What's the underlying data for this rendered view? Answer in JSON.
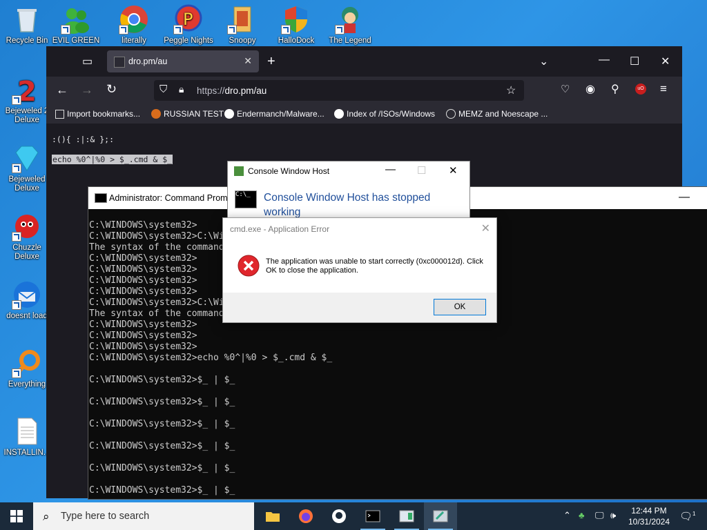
{
  "desktop": {
    "top_icons": [
      {
        "label": "Recycle Bin"
      },
      {
        "label": "EVIL GREEN"
      },
      {
        "label": "literally"
      },
      {
        "label": "Peggle Nights"
      },
      {
        "label": "Snoopy"
      },
      {
        "label": "HalloDock"
      },
      {
        "label": "The Legend"
      }
    ],
    "left_icons": [
      {
        "label": "Bejeweled 2 Deluxe"
      },
      {
        "label": "Bejeweled Deluxe"
      },
      {
        "label": "Chuzzle Deluxe"
      },
      {
        "label": "doesnt load"
      },
      {
        "label": "Everything"
      },
      {
        "label": "INSTALLIN..."
      }
    ]
  },
  "browser": {
    "tab_title": "dro.pm/au",
    "url_scheme": "https://",
    "url_host": "dro.pm/au",
    "bookmarks": [
      {
        "label": "Import bookmarks..."
      },
      {
        "label": "RUSSIAN TEST"
      },
      {
        "label": "Endermanch/Malware..."
      },
      {
        "label": "Index of /ISOs/Windows"
      },
      {
        "label": "MEMZ and Noescape ..."
      }
    ],
    "content_line1": ":(){ :|:& };:",
    "content_line2": "echo %0^|%0 > $_.cmd & $_"
  },
  "cmd": {
    "title": "Administrator: Command Prompt",
    "lines": [
      "C:\\WINDOWS\\system32>",
      "C:\\WINDOWS\\system32>C:\\Wi",
      "The syntax of the command",
      "C:\\WINDOWS\\system32>",
      "C:\\WINDOWS\\system32>",
      "C:\\WINDOWS\\system32>",
      "C:\\WINDOWS\\system32>",
      "C:\\WINDOWS\\system32>C:\\Wi",
      "The syntax of the command",
      "C:\\WINDOWS\\system32>",
      "C:\\WINDOWS\\system32>",
      "C:\\WINDOWS\\system32>",
      "C:\\WINDOWS\\system32>echo %0^|%0 > $_.cmd & $_",
      "",
      "C:\\WINDOWS\\system32>$_ | $_",
      "",
      "C:\\WINDOWS\\system32>$_ | $_",
      "",
      "C:\\WINDOWS\\system32>$_ | $_",
      "",
      "C:\\WINDOWS\\system32>$_ | $_",
      "",
      "C:\\WINDOWS\\system32>$_ | $_",
      "",
      "C:\\WINDOWS\\system32>$_ | $_"
    ]
  },
  "cwh_dialog": {
    "title": "Console Window Host",
    "message": "Console Window Host has stopped working"
  },
  "error_dialog": {
    "title": "cmd.exe - Application Error",
    "message": "The application was unable to start correctly (0xc000012d). Click OK to close the application.",
    "ok_label": "OK"
  },
  "taskbar": {
    "search_placeholder": "Type here to search",
    "time": "12:44 PM",
    "date": "10/31/2024",
    "notification_count": "1"
  },
  "colors": {
    "desktop": "#2e95e6",
    "browser_bg": "#1c1b22",
    "accent": "#0078d7"
  }
}
